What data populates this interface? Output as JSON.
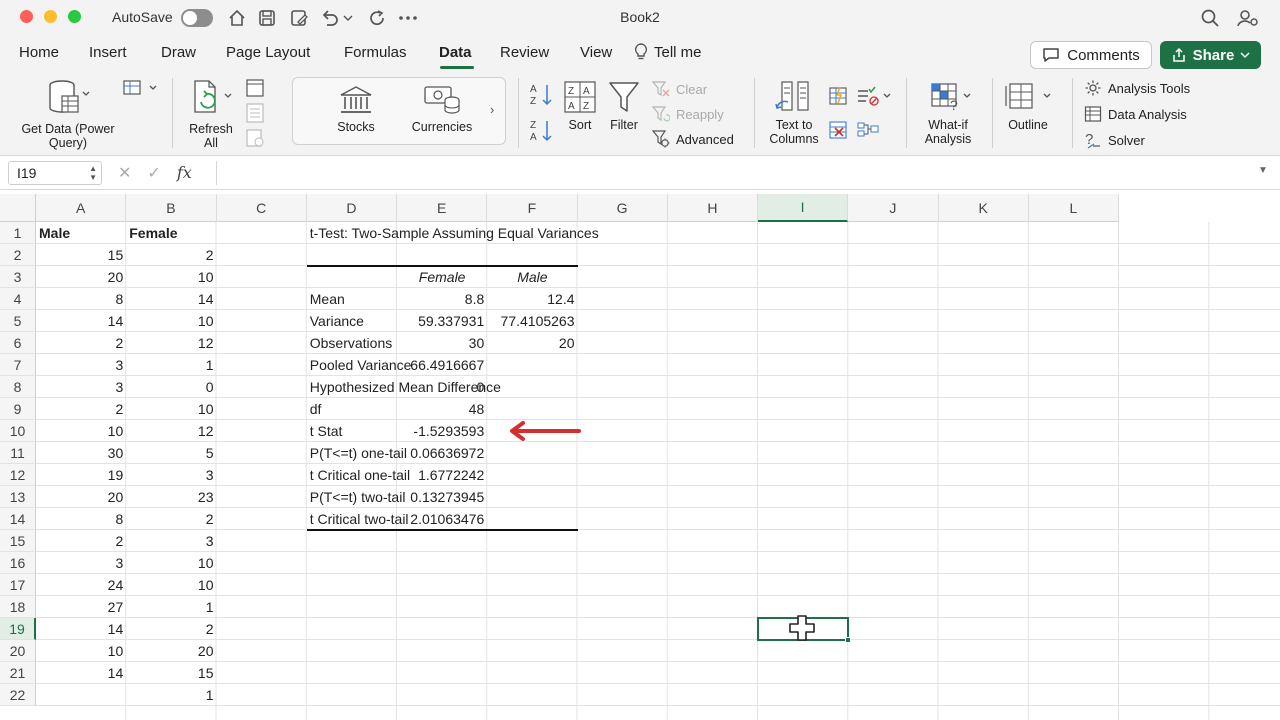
{
  "titlebar": {
    "autosave_label": "AutoSave",
    "document_title": "Book2"
  },
  "tabs": [
    {
      "label": "Home"
    },
    {
      "label": "Insert"
    },
    {
      "label": "Draw"
    },
    {
      "label": "Page Layout"
    },
    {
      "label": "Formulas"
    },
    {
      "label": "Data",
      "active": true
    },
    {
      "label": "Review"
    },
    {
      "label": "View"
    },
    {
      "label": "Tell me"
    }
  ],
  "header_buttons": {
    "comments": "Comments",
    "share": "Share"
  },
  "ribbon": {
    "get_data": "Get Data (Power Query)",
    "get_data_line1": "Get Data (Power",
    "get_data_line2": "Query)",
    "refresh_line1": "Refresh",
    "refresh_line2": "All",
    "stocks": "Stocks",
    "currencies": "Currencies",
    "sort": "Sort",
    "filter": "Filter",
    "clear": "Clear",
    "reapply": "Reapply",
    "advanced": "Advanced",
    "text_to_columns_line1": "Text to",
    "text_to_columns_line2": "Columns",
    "what_if_line1": "What-if",
    "what_if_line2": "Analysis",
    "outline": "Outline",
    "analysis_tools": "Analysis Tools",
    "data_analysis": "Data Analysis",
    "solver": "Solver"
  },
  "formula_bar": {
    "name_box": "I19",
    "formula": ""
  },
  "columns": [
    "A",
    "B",
    "C",
    "D",
    "E",
    "F",
    "G",
    "H",
    "I",
    "J",
    "K",
    "L"
  ],
  "selected_column": "I",
  "rows": [
    "1",
    "2",
    "3",
    "4",
    "5",
    "6",
    "7",
    "8",
    "9",
    "10",
    "11",
    "12",
    "13",
    "14",
    "15",
    "16",
    "17",
    "18",
    "19",
    "20",
    "21",
    "22"
  ],
  "selected_row": "19",
  "sheet": {
    "headers": {
      "male": "Male",
      "female": "Female"
    },
    "male": [
      "15",
      "20",
      "8",
      "14",
      "2",
      "3",
      "3",
      "2",
      "10",
      "30",
      "19",
      "20",
      "8",
      "2",
      "3",
      "24",
      "27",
      "14",
      "10",
      "14",
      ""
    ],
    "female": [
      "2",
      "10",
      "14",
      "10",
      "12",
      "1",
      "0",
      "10",
      "12",
      "5",
      "3",
      "23",
      "2",
      "3",
      "10",
      "10",
      "1",
      "2",
      "20",
      "15",
      "1"
    ],
    "ttest": {
      "title": "t-Test: Two-Sample Assuming Equal Variances",
      "col_female": "Female",
      "col_male": "Male",
      "rows": [
        {
          "label": "Mean",
          "female": "8.8",
          "male": "12.4"
        },
        {
          "label": "Variance",
          "female": "59.337931",
          "male": "77.4105263"
        },
        {
          "label": "Observations",
          "female": "30",
          "male": "20"
        },
        {
          "label": "Pooled Variance",
          "female": "66.4916667",
          "male": ""
        },
        {
          "label": "Hypothesized Mean Difference",
          "female": "0",
          "male": ""
        },
        {
          "label": "df",
          "female": "48",
          "male": ""
        },
        {
          "label": "t Stat",
          "female": "-1.5293593",
          "male": ""
        },
        {
          "label": "P(T<=t) one-tail",
          "female": "0.06636972",
          "male": ""
        },
        {
          "label": "t Critical one-tail",
          "female": "1.6772242",
          "male": ""
        },
        {
          "label": "P(T<=t) two-tail",
          "female": "0.13273945",
          "male": ""
        },
        {
          "label": "t Critical two-tail",
          "female": "2.01063476",
          "male": ""
        }
      ]
    }
  },
  "colors": {
    "accent_green": "#1e7145",
    "annotation_arrow": "#d32f2f"
  }
}
